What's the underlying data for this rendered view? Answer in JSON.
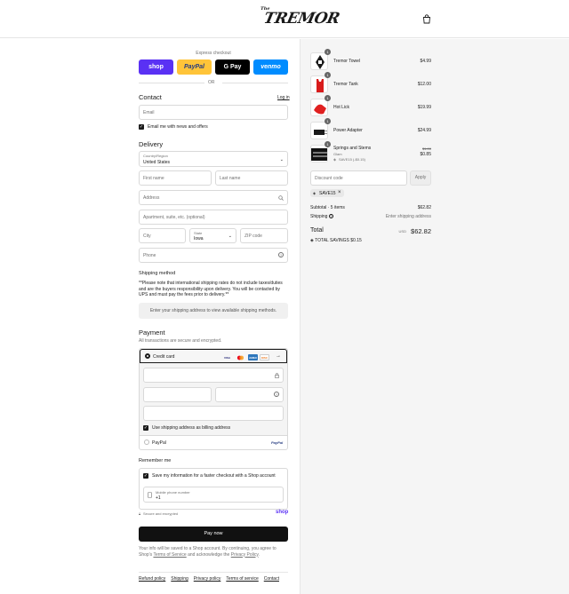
{
  "header": {
    "logo_small": "The",
    "logo_big": "TREMOR",
    "cart_icon": "shopping-bag-icon"
  },
  "express": {
    "label": "Express checkout",
    "buttons": [
      {
        "label": "shop",
        "bg": "#5a31f4",
        "fg": "#ffffff"
      },
      {
        "label": "PayPal",
        "bg": "#ffc439",
        "fg": "#253b80"
      },
      {
        "label": "G Pay",
        "bg": "#000000",
        "fg": "#ffffff"
      },
      {
        "label": "venmo",
        "bg": "#008cff",
        "fg": "#ffffff"
      }
    ],
    "or": "OR"
  },
  "contact": {
    "title": "Contact",
    "login": "Log in",
    "email_placeholder": "Email",
    "news_label": "Email me with news and offers"
  },
  "delivery": {
    "title": "Delivery",
    "country_label": "Country/Region",
    "country_value": "United States",
    "first_name": "First name",
    "last_name": "Last name",
    "address": "Address",
    "apartment": "Apartment, suite, etc. (optional)",
    "city": "City",
    "state_label": "State",
    "state_value": "Iowa",
    "zip": "ZIP code",
    "phone": "Phone"
  },
  "shipping": {
    "title": "Shipping method",
    "note": "**Please note that international shipping rates do not include taxes/duties and are the buyers responsibility upon delivery. You will be contacted by UPS and must pay the fees prior to delivery.**",
    "notice": "Enter your shipping address to view available shipping methods."
  },
  "payment": {
    "title": "Payment",
    "subtitle": "All transactions are secure and encrypted.",
    "credit_card": "Credit card",
    "billing_label": "Use shipping address as billing address",
    "paypal": "PayPal",
    "paypal_logo": "PayPal",
    "card_brands": [
      "VISA",
      "MC",
      "AMEX",
      "DISC"
    ]
  },
  "remember": {
    "title": "Remember me",
    "save_label": "Save my information for a faster checkout with a Shop account",
    "mobile_label": "Mobile phone number",
    "mobile_value": "+1",
    "secure": "Secure and encrypted",
    "shop": "shop"
  },
  "pay_now": "Pay now",
  "legal": {
    "text": "Your info will be saved to a Shop account. By continuing, you agree to Shop's",
    "terms": "Terms of Service",
    "and": "and acknowledge the",
    "privacy": "Privacy Policy",
    "end": "."
  },
  "footer": [
    "Refund policy",
    "Shipping",
    "Privacy policy",
    "Terms of service",
    "Contact"
  ],
  "cart": {
    "items": [
      {
        "qty": "1",
        "name": "Tremor Towel",
        "price": "$4.99"
      },
      {
        "qty": "1",
        "name": "Tremor Tank",
        "price": "$12.00"
      },
      {
        "qty": "1",
        "name": "Hot Lick",
        "price": "$19.99"
      },
      {
        "qty": "1",
        "name": "Power Adapter",
        "price": "$24.99"
      },
      {
        "qty": "1",
        "name": "Springs and Stems",
        "variant": "Glam",
        "discount_tag": "SAVE15 (-$0.15)",
        "old_price": "$1.00",
        "price": "$0.85"
      }
    ],
    "discount_placeholder": "Discount code",
    "apply": "Apply",
    "applied_code": "SAVE15",
    "subtotal_label": "Subtotal · 5 items",
    "subtotal_value": "$62.82",
    "shipping_label": "Shipping",
    "shipping_value": "Enter shipping address",
    "total_label": "Total",
    "currency": "USD",
    "total_value": "$62.82",
    "savings_label": "TOTAL SAVINGS",
    "savings_value": "$0.15"
  }
}
